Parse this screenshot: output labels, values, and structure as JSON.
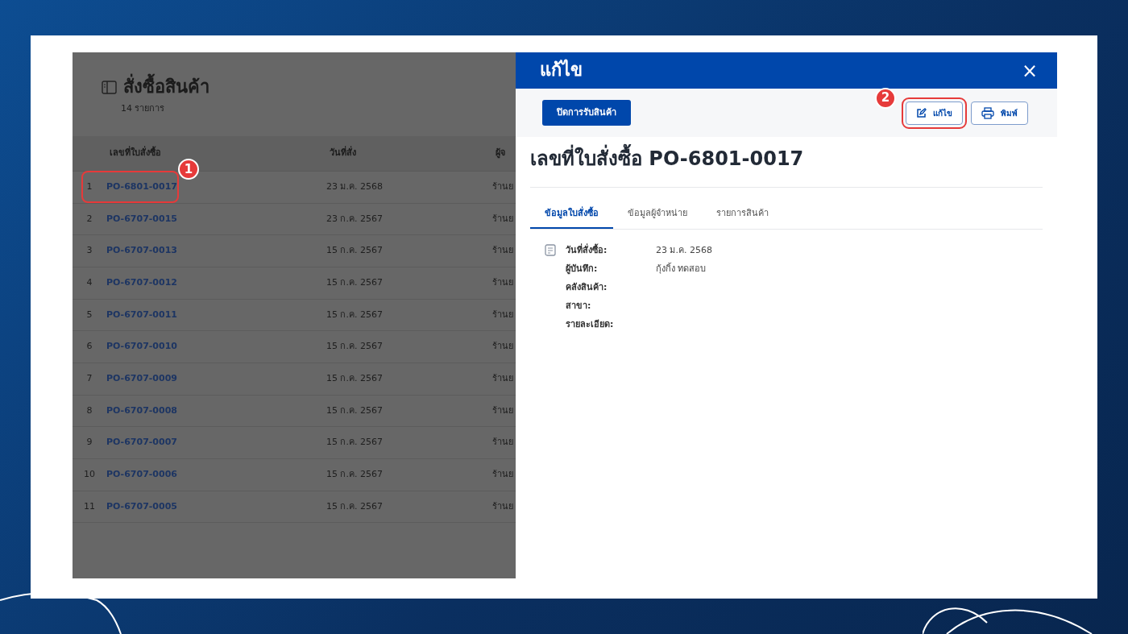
{
  "list": {
    "title": "สั่งซื้อสินค้า",
    "count": "14 รายการ",
    "columns": [
      "เลขที่ใบสั่งซื้อ",
      "วันที่สั่ง",
      "ผู้จ"
    ],
    "rows": [
      {
        "index": "1",
        "po": "PO-6801-0017",
        "date": "23 ม.ค. 2568",
        "column_3": "ร้านย",
        "highlighted": true,
        "callout": "1"
      },
      {
        "index": "2",
        "po": "PO-6707-0015",
        "date": "23 ก.ค. 2567",
        "column_3": "ร้านย",
        "highlighted": false
      },
      {
        "index": "3",
        "po": "PO-6707-0013",
        "date": "15 ก.ค. 2567",
        "column_3": "ร้านย",
        "highlighted": false
      },
      {
        "index": "4",
        "po": "PO-6707-0012",
        "date": "15 ก.ค. 2567",
        "column_3": "ร้านย",
        "highlighted": false
      },
      {
        "index": "5",
        "po": "PO-6707-0011",
        "date": "15 ก.ค. 2567",
        "column_3": "ร้านย",
        "highlighted": false
      },
      {
        "index": "6",
        "po": "PO-6707-0010",
        "date": "15 ก.ค. 2567",
        "column_3": "ร้านย",
        "highlighted": false
      },
      {
        "index": "7",
        "po": "PO-6707-0009",
        "date": "15 ก.ค. 2567",
        "column_3": "ร้านย",
        "highlighted": false
      },
      {
        "index": "8",
        "po": "PO-6707-0008",
        "date": "15 ก.ค. 2567",
        "column_3": "ร้านย",
        "highlighted": false
      },
      {
        "index": "9",
        "po": "PO-6707-0007",
        "date": "15 ก.ค. 2567",
        "column_3": "ร้านย",
        "highlighted": false
      },
      {
        "index": "10",
        "po": "PO-6707-0006",
        "date": "15 ก.ค. 2567",
        "column_3": "ร้านย",
        "highlighted": false
      },
      {
        "index": "11",
        "po": "PO-6707-0005",
        "date": "15 ก.ค. 2567",
        "column_3": "ร้านย",
        "highlighted": false
      }
    ]
  },
  "drawer": {
    "title": "แก้ไข",
    "close": "×",
    "toolbar": [
      {
        "label": "ปิดการรับสินค้า",
        "kind": "primary"
      },
      {
        "label": "แก้ไข",
        "kind": "edit",
        "highlighted": true,
        "callout": "2"
      },
      {
        "label": "พิมพ์",
        "kind": "print",
        "highlighted": false
      }
    ],
    "heading": "เลขที่ใบสั่งซื้อ PO-6801-0017",
    "tabs": [
      {
        "label": "ข้อมูลใบสั่งซื้อ",
        "selected": true
      },
      {
        "label": "ข้อมูลผู้จำหน่าย",
        "selected": false
      },
      {
        "label": "รายการสินค้า",
        "selected": false
      }
    ],
    "fields": [
      {
        "label": "วันที่สั่งซื้อ:",
        "value": "23 ม.ค. 2568"
      },
      {
        "label": "ผู้บันทึก:",
        "value": "กุ้งกิ้ง ทดสอบ"
      },
      {
        "label": "คลังสินค้า:"
      },
      {
        "label": "สาขา:"
      },
      {
        "label": "รายละเอียด:"
      }
    ]
  }
}
